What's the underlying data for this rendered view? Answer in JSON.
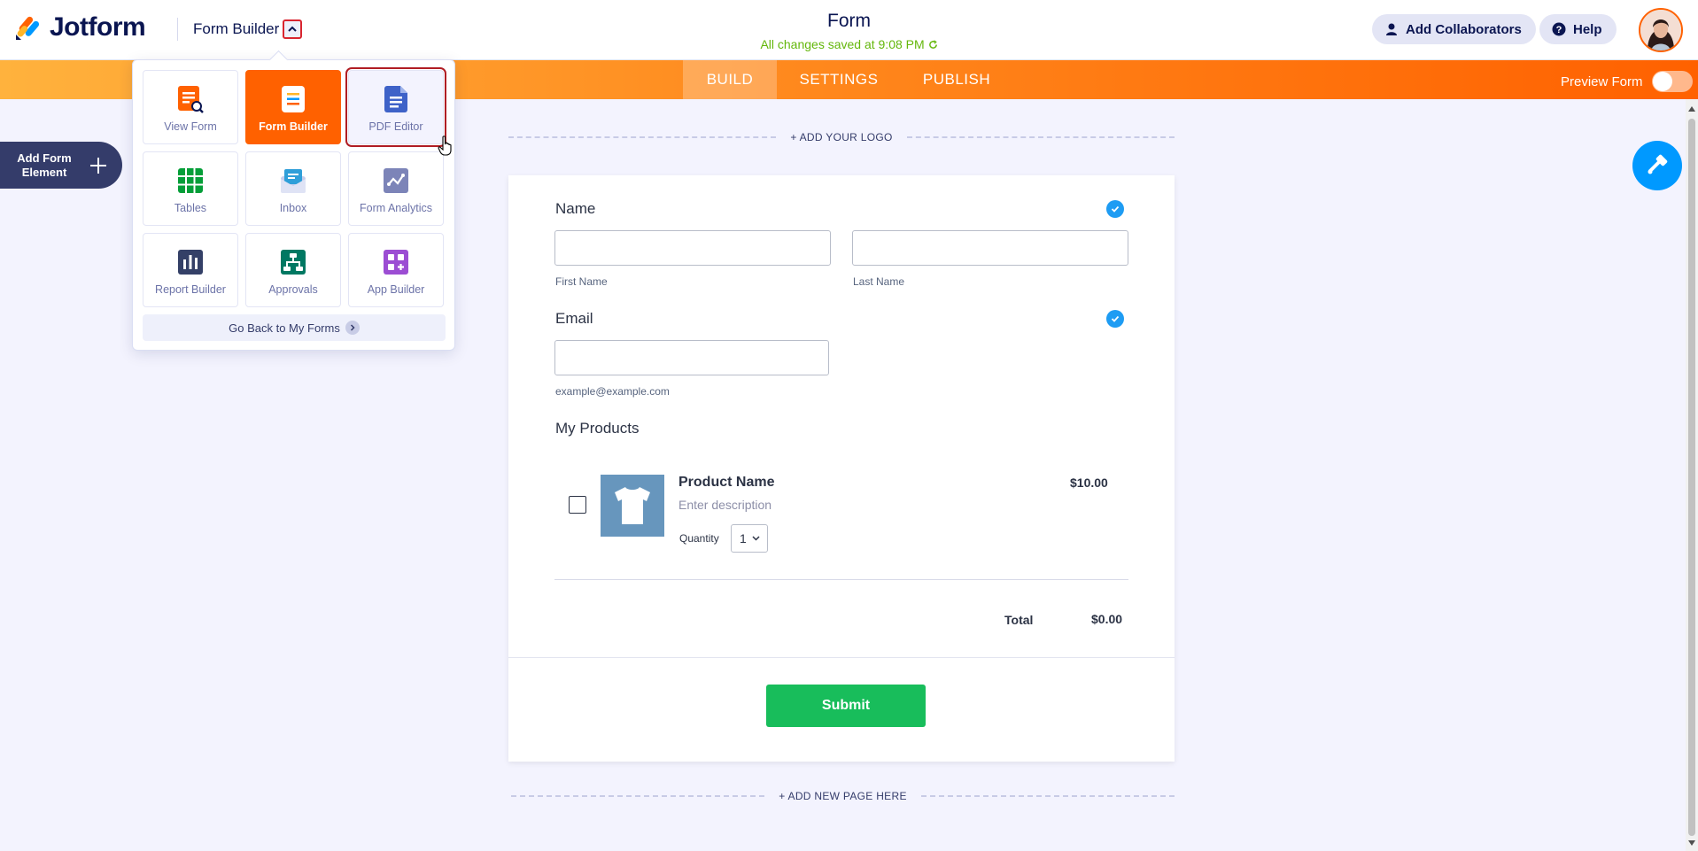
{
  "header": {
    "logo_text": "Jotform",
    "builder_switch_label": "Form Builder",
    "form_title": "Form",
    "saved_status": "All changes saved at 9:08 PM",
    "collaborators_label": "Add Collaborators",
    "help_label": "Help"
  },
  "nav": {
    "tabs": [
      {
        "label": "BUILD",
        "active": true
      },
      {
        "label": "SETTINGS",
        "active": false
      },
      {
        "label": "PUBLISH",
        "active": false
      }
    ],
    "preview_label": "Preview Form",
    "preview_enabled": false
  },
  "sidebar": {
    "add_element_line1": "Add Form",
    "add_element_line2": "Element"
  },
  "app_switcher": {
    "tiles": [
      {
        "label": "View Form",
        "icon": "view-form-icon"
      },
      {
        "label": "Form Builder",
        "icon": "form-builder-icon",
        "active": true
      },
      {
        "label": "PDF Editor",
        "icon": "pdf-editor-icon",
        "hovered": true
      },
      {
        "label": "Tables",
        "icon": "tables-icon"
      },
      {
        "label": "Inbox",
        "icon": "inbox-icon"
      },
      {
        "label": "Form Analytics",
        "icon": "form-analytics-icon"
      },
      {
        "label": "Report Builder",
        "icon": "report-builder-icon"
      },
      {
        "label": "Approvals",
        "icon": "approvals-icon"
      },
      {
        "label": "App Builder",
        "icon": "app-builder-icon"
      }
    ],
    "go_back_label": "Go Back to My Forms"
  },
  "canvas": {
    "add_logo_label": "+ ADD YOUR LOGO",
    "add_page_label": "+ ADD NEW PAGE HERE"
  },
  "form": {
    "name": {
      "label": "Name",
      "first_sublabel": "First Name",
      "last_sublabel": "Last Name"
    },
    "email": {
      "label": "Email",
      "sublabel": "example@example.com"
    },
    "products": {
      "label": "My Products",
      "items": [
        {
          "name": "Product Name",
          "description": "Enter description",
          "price": "$10.00",
          "quantity_label": "Quantity",
          "quantity": "1"
        }
      ],
      "total_label": "Total",
      "total_value": "$0.00"
    },
    "submit_label": "Submit"
  },
  "colors": {
    "brand_orange": "#ff6100",
    "navy": "#0a1551",
    "submit_green": "#18bd5b",
    "check_blue": "#1e9cf3",
    "saved_green": "#64b70b"
  }
}
